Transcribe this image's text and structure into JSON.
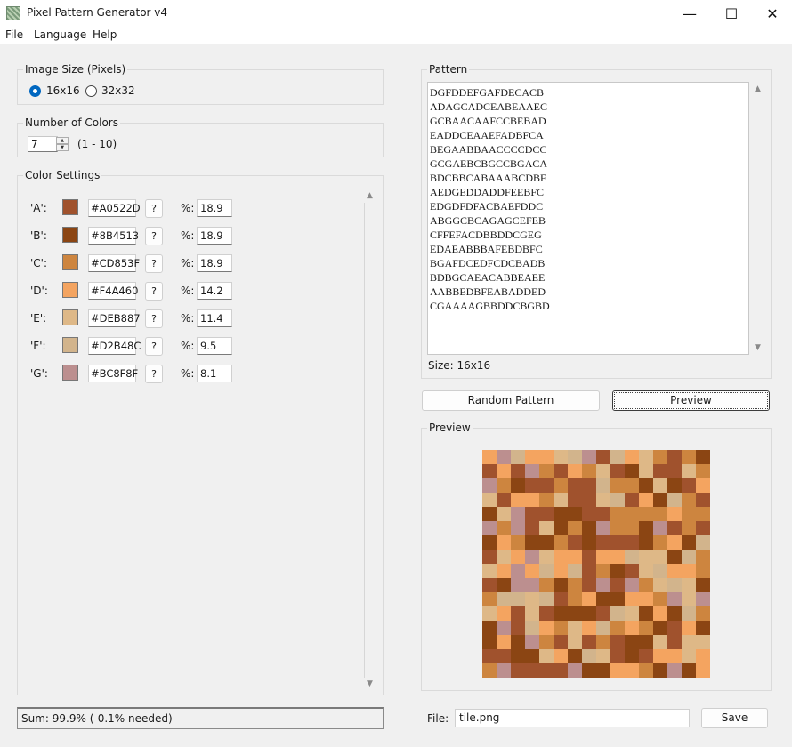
{
  "window": {
    "title": "Pixel Pattern Generator v4",
    "controls": {
      "minimize": "—",
      "maximize": "☐",
      "close": "✕"
    }
  },
  "menu": [
    "File",
    "Language",
    "Help"
  ],
  "image_size": {
    "title": "Image Size (Pixels)",
    "options": [
      {
        "label": "16x16",
        "selected": true
      },
      {
        "label": "32x32",
        "selected": false
      }
    ]
  },
  "num_colors": {
    "title": "Number of Colors",
    "value": "7",
    "range": "(1 - 10)"
  },
  "color_settings": {
    "title": "Color Settings",
    "help_label": "?",
    "pct_label": "%:",
    "colors": [
      {
        "label": "'A':",
        "hex": "#A0522D",
        "pct": "18.9"
      },
      {
        "label": "'B':",
        "hex": "#8B4513",
        "pct": "18.9"
      },
      {
        "label": "'C':",
        "hex": "#CD853F",
        "pct": "18.9"
      },
      {
        "label": "'D':",
        "hex": "#F4A460",
        "pct": "14.2"
      },
      {
        "label": "'E':",
        "hex": "#DEB887",
        "pct": "11.4"
      },
      {
        "label": "'F':",
        "hex": "#D2B48C",
        "pct": "9.5"
      },
      {
        "label": "'G':",
        "hex": "#BC8F8F",
        "pct": "8.1"
      }
    ]
  },
  "status": "Sum: 99.9% (-0.1% needed)",
  "pattern": {
    "title": "Pattern",
    "size_label": "Size: 16x16",
    "rows": [
      "DGFDDEFGAFDECACB",
      "ADAGCADCEABEAAEC",
      "GCBAACAAFCCBEBAD",
      "EADDCEAAEFADBFCA",
      "BEGAABBAACCCCDCC",
      "GCGAEBCBGCCBGACA",
      "BDCBBCABAAABCDBF",
      "AEDGEDDADDFEEBFC",
      "EDGDFDFACBAEFDDC",
      "ABGGCBCAGAGCEFEB",
      "CFFEFACDBBDDCGEG",
      "EDAEABBBAFEBDBFC",
      "BGAFDCEDFCDCBADB",
      "BDBGCAEACABBEAEE",
      "AABBEDBFEABADDED",
      "CGAAAAGBBDDCBGBD"
    ]
  },
  "buttons": {
    "random": "Random Pattern",
    "preview": "Preview",
    "save": "Save"
  },
  "preview": {
    "title": "Preview"
  },
  "file": {
    "label": "File:",
    "value": "tile.png"
  },
  "icons": {
    "scroll_up": "▲",
    "scroll_down": "▼",
    "spin_up": "▲",
    "spin_down": "▼"
  }
}
